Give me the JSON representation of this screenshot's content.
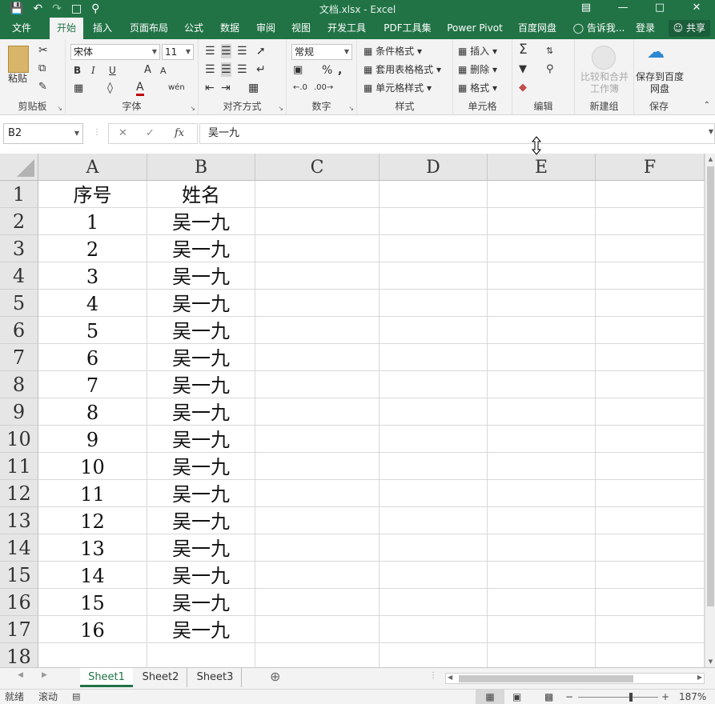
{
  "window": {
    "title": "文档.xlsx - Excel"
  },
  "quick_access": {
    "save_icon": "save-icon",
    "undo_icon": "undo-icon",
    "redo_icon": "redo-icon",
    "new_icon": "new-file-icon",
    "preview_icon": "print-preview-icon"
  },
  "tabs": [
    "文件",
    "开始",
    "插入",
    "页面布局",
    "公式",
    "数据",
    "审阅",
    "视图",
    "开发工具",
    "PDF工具集",
    "Power Pivot",
    "百度网盘"
  ],
  "active_tab": "开始",
  "tellme": "告诉我...",
  "login": "登录",
  "share": "共享",
  "ribbon": {
    "clipboard": {
      "label": "剪贴板",
      "paste": "粘贴"
    },
    "font": {
      "label": "字体",
      "name": "宋体",
      "size": "11",
      "bold": "B",
      "italic": "I",
      "underline": "U",
      "grow": "A",
      "shrink": "A",
      "font_color": "A"
    },
    "alignment": {
      "label": "对齐方式"
    },
    "number": {
      "label": "数字",
      "format": "常规",
      "percent": "%",
      "comma": ","
    },
    "styles": {
      "label": "样式",
      "conditional": "条件格式",
      "table": "套用表格格式",
      "cell_style": "单元格样式"
    },
    "cells": {
      "label": "单元格",
      "insert": "插入",
      "delete": "删除",
      "format": "格式"
    },
    "editing": {
      "label": "编辑"
    },
    "newgroup": {
      "label": "新建组",
      "compare": "比较和合并工作簿"
    },
    "save": {
      "label": "保存",
      "save_baidu": "保存到百度网盘"
    }
  },
  "formula_bar": {
    "name_box": "B2",
    "formula": "吴一九"
  },
  "columns": [
    "A",
    "B",
    "C",
    "D",
    "E",
    "F"
  ],
  "rows": [
    [
      "序号",
      "姓名"
    ],
    [
      "1",
      "吴一九"
    ],
    [
      "2",
      "吴一九"
    ],
    [
      "3",
      "吴一九"
    ],
    [
      "4",
      "吴一九"
    ],
    [
      "5",
      "吴一九"
    ],
    [
      "6",
      "吴一九"
    ],
    [
      "7",
      "吴一九"
    ],
    [
      "8",
      "吴一九"
    ],
    [
      "9",
      "吴一九"
    ],
    [
      "10",
      "吴一九"
    ],
    [
      "11",
      "吴一九"
    ],
    [
      "12",
      "吴一九"
    ],
    [
      "13",
      "吴一九"
    ],
    [
      "14",
      "吴一九"
    ],
    [
      "15",
      "吴一九"
    ],
    [
      "16",
      "吴一九"
    ],
    [
      "",
      ""
    ]
  ],
  "sheets": [
    "Sheet1",
    "Sheet2",
    "Sheet3"
  ],
  "active_sheet": "Sheet1",
  "status": {
    "ready": "就绪",
    "scroll": "滚动",
    "zoom": "187%",
    "minus": "−",
    "plus": "+"
  }
}
